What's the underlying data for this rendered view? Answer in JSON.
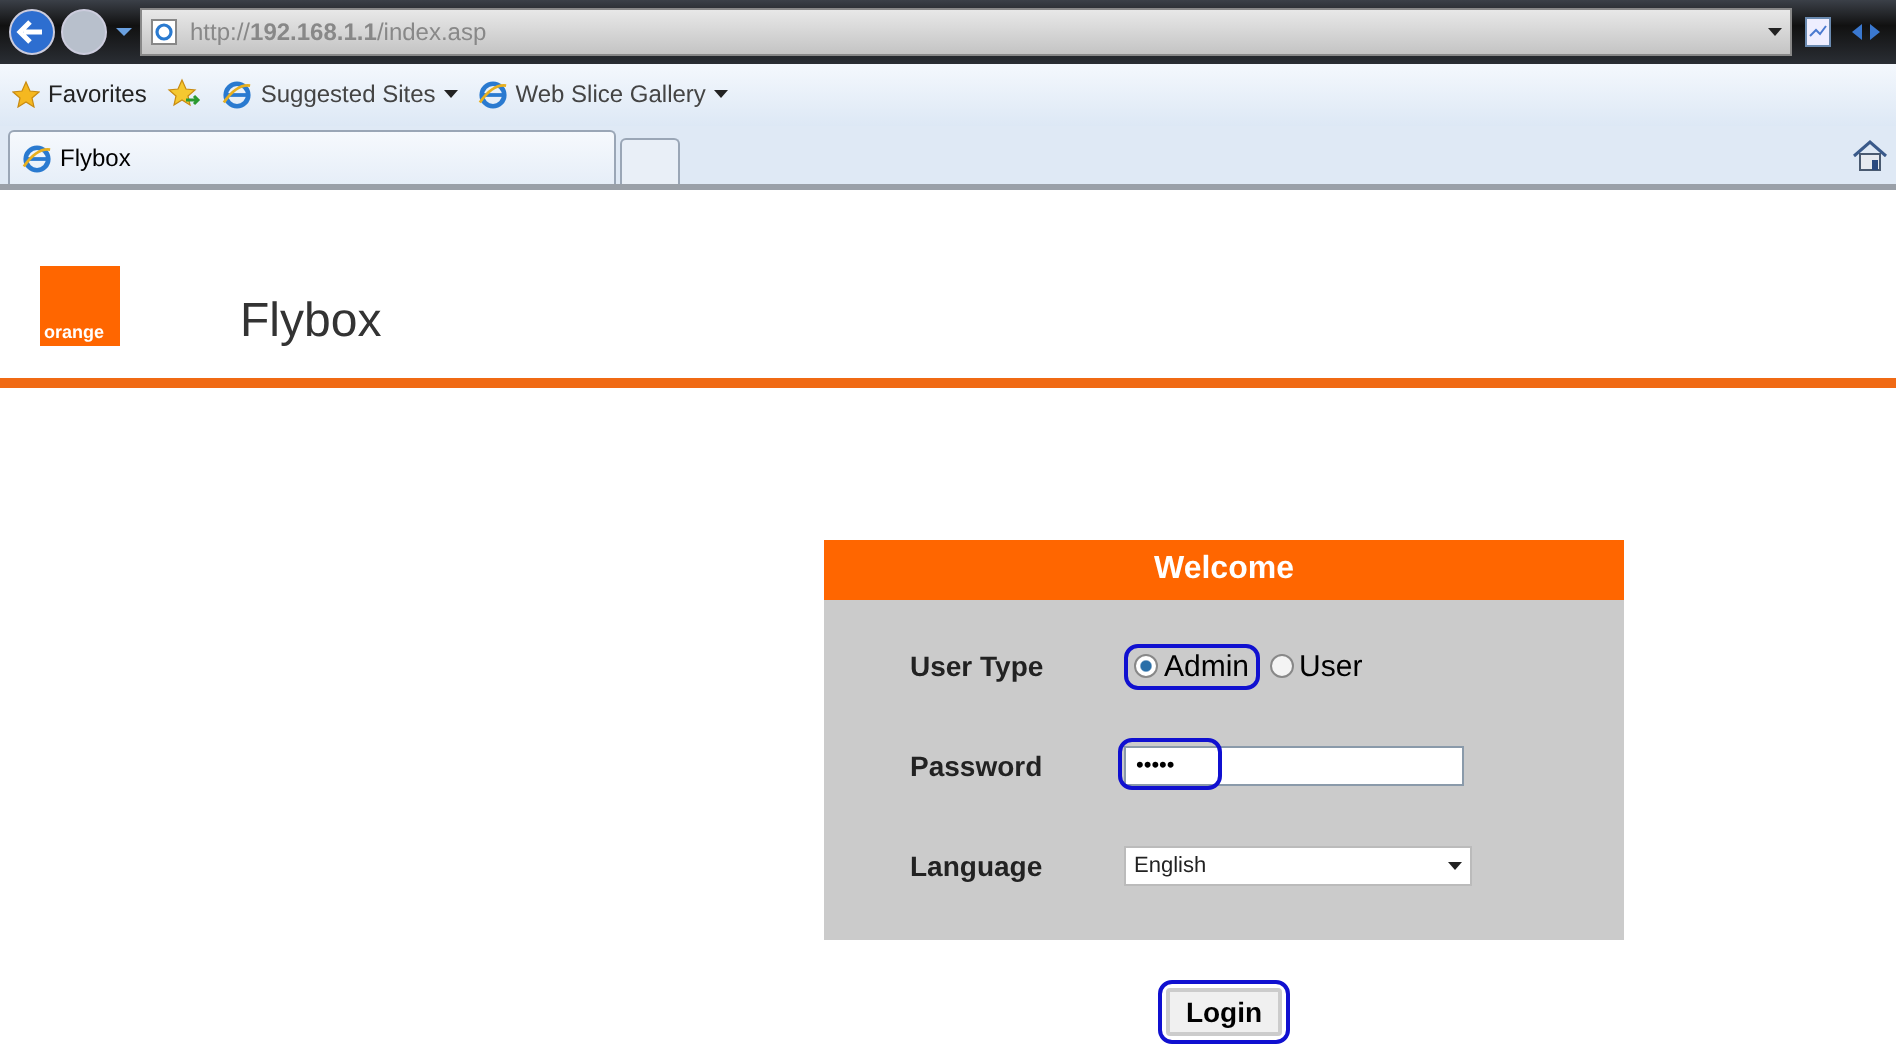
{
  "browser": {
    "url": "http://**192.168.1.1**/index.asp",
    "favorites": "Favorites",
    "links": [
      {
        "label": "Suggested Sites"
      },
      {
        "label": "Web Slice Gallery"
      }
    ],
    "tabs": [
      {
        "label": "Flybox",
        "selected": true
      }
    ]
  },
  "header": {
    "logo": "orange",
    "title": "Flybox"
  },
  "login": {
    "title": "Welcome",
    "user_type": {
      "label": "User Type",
      "options": [
        {
          "label": "Admin",
          "selected": true,
          "highlighted": true
        },
        {
          "label": "User",
          "selected": false,
          "highlighted": false
        }
      ]
    },
    "password": {
      "label": "Password",
      "value": "•••••",
      "highlighted": true
    },
    "language": {
      "label": "Language",
      "value": "English"
    },
    "button": {
      "label": "Login",
      "highlighted": true
    }
  }
}
